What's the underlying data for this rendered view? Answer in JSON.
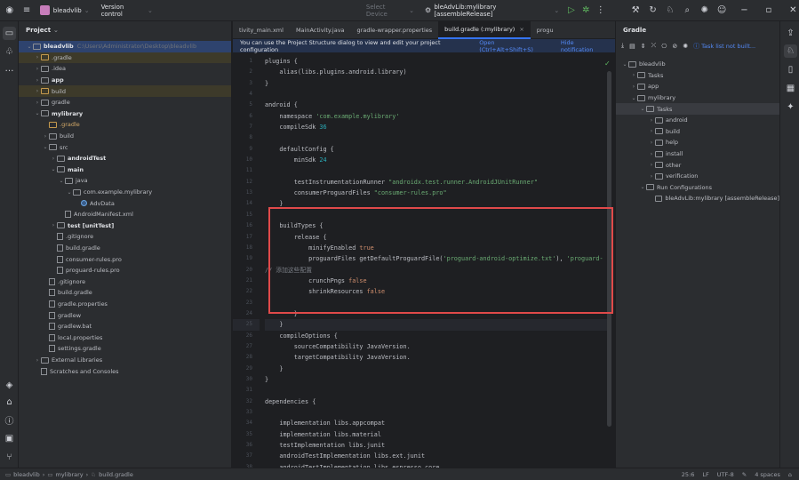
{
  "titlebar": {
    "project_name": "bleadvlib",
    "vcs": "Version control",
    "device": "Select Device",
    "run_config": "bleAdvLib:mylibrary [assembleRelease]"
  },
  "project_panel": {
    "title": "Project",
    "tree": [
      {
        "indent": 0,
        "chev": "v",
        "icon": "folder",
        "label": "bleadvlib",
        "bold": true,
        "extra": "C:\\Users\\Administrator\\Desktop\\bleadvlib",
        "sel": true
      },
      {
        "indent": 1,
        "chev": ">",
        "icon": "folder-orange",
        "label": ".gradle",
        "hl": true
      },
      {
        "indent": 1,
        "chev": ">",
        "icon": "folder",
        "label": ".idea"
      },
      {
        "indent": 1,
        "chev": ">",
        "icon": "folder",
        "label": "app",
        "bold": true
      },
      {
        "indent": 1,
        "chev": ">",
        "icon": "folder-orange",
        "label": "build",
        "hl": true
      },
      {
        "indent": 1,
        "chev": ">",
        "icon": "folder",
        "label": "gradle"
      },
      {
        "indent": 1,
        "chev": "v",
        "icon": "folder",
        "label": "mylibrary",
        "bold": true
      },
      {
        "indent": 2,
        "chev": "",
        "icon": "folder-orange",
        "label": ".gradle",
        "orange": true
      },
      {
        "indent": 2,
        "chev": ">",
        "icon": "folder",
        "label": "build"
      },
      {
        "indent": 2,
        "chev": "v",
        "icon": "folder",
        "label": "src"
      },
      {
        "indent": 3,
        "chev": ">",
        "icon": "folder",
        "label": "androidTest",
        "bold": true
      },
      {
        "indent": 3,
        "chev": "v",
        "icon": "folder",
        "label": "main",
        "bold": true
      },
      {
        "indent": 4,
        "chev": "v",
        "icon": "folder",
        "label": "java"
      },
      {
        "indent": 5,
        "chev": "v",
        "icon": "folder",
        "label": "com.example.mylibrary"
      },
      {
        "indent": 6,
        "chev": "",
        "icon": "kotlin",
        "label": "AdvData"
      },
      {
        "indent": 4,
        "chev": "",
        "icon": "file",
        "label": "AndroidManifest.xml"
      },
      {
        "indent": 3,
        "chev": ">",
        "icon": "folder",
        "label": "test [unitTest]",
        "bold": true
      },
      {
        "indent": 3,
        "chev": "",
        "icon": "file",
        "label": ".gitignore"
      },
      {
        "indent": 3,
        "chev": "",
        "icon": "file",
        "label": "build.gradle"
      },
      {
        "indent": 3,
        "chev": "",
        "icon": "file",
        "label": "consumer-rules.pro"
      },
      {
        "indent": 3,
        "chev": "",
        "icon": "file",
        "label": "proguard-rules.pro"
      },
      {
        "indent": 2,
        "chev": "",
        "icon": "file",
        "label": ".gitignore"
      },
      {
        "indent": 2,
        "chev": "",
        "icon": "file",
        "label": "build.gradle"
      },
      {
        "indent": 2,
        "chev": "",
        "icon": "file",
        "label": "gradle.properties"
      },
      {
        "indent": 2,
        "chev": "",
        "icon": "file",
        "label": "gradlew"
      },
      {
        "indent": 2,
        "chev": "",
        "icon": "file",
        "label": "gradlew.bat"
      },
      {
        "indent": 2,
        "chev": "",
        "icon": "file",
        "label": "local.properties"
      },
      {
        "indent": 2,
        "chev": "",
        "icon": "file",
        "label": "settings.gradle"
      },
      {
        "indent": 1,
        "chev": ">",
        "icon": "lib",
        "label": "External Libraries"
      },
      {
        "indent": 1,
        "chev": "",
        "icon": "file",
        "label": "Scratches and Consoles"
      }
    ]
  },
  "editor": {
    "tabs": [
      {
        "label": "tivity_main.xml",
        "active": false
      },
      {
        "label": "MainActivity.java",
        "active": false
      },
      {
        "label": "gradle-wrapper.properties",
        "active": false
      },
      {
        "label": "build.gradle (:mylibrary)",
        "active": true
      },
      {
        "label": "progu",
        "active": false
      }
    ],
    "notice": "You can use the Project Structure dialog to view and edit your project configuration",
    "notice_open": "Open (Ctrl+Alt+Shift+S)",
    "notice_hide": "Hide notification",
    "lines": [
      {
        "n": "1",
        "t": "plugins {"
      },
      {
        "n": "2",
        "t": "    alias(libs.plugins.android.library)"
      },
      {
        "n": "3",
        "t": "}"
      },
      {
        "n": "4",
        "t": ""
      },
      {
        "n": "5",
        "t": "android {"
      },
      {
        "n": "6",
        "t": "    namespace 'com.example.mylibrary'"
      },
      {
        "n": "7",
        "t": "    compileSdk 36"
      },
      {
        "n": "8",
        "t": ""
      },
      {
        "n": "9",
        "t": "    defaultConfig {"
      },
      {
        "n": "10",
        "t": "        minSdk 24"
      },
      {
        "n": "11",
        "t": ""
      },
      {
        "n": "12",
        "t": "        testInstrumentationRunner \"androidx.test.runner.AndroidJUnitRunner\""
      },
      {
        "n": "13",
        "t": "        consumerProguardFiles \"consumer-rules.pro\""
      },
      {
        "n": "14",
        "t": "    }"
      },
      {
        "n": "15",
        "t": ""
      },
      {
        "n": "16",
        "t": "    buildTypes {"
      },
      {
        "n": "17",
        "t": "        release {"
      },
      {
        "n": "18",
        "t": "            minifyEnabled true"
      },
      {
        "n": "19",
        "t": "            proguardFiles getDefaultProguardFile('proguard-android-optimize.txt'), 'proguard-"
      },
      {
        "n": "20",
        "t": "// 添加这些配置"
      },
      {
        "n": "21",
        "t": "            crunchPngs false"
      },
      {
        "n": "22",
        "t": "            shrinkResources false"
      },
      {
        "n": "23",
        "t": ""
      },
      {
        "n": "24",
        "t": "        }"
      },
      {
        "n": "25",
        "t": "    }"
      },
      {
        "n": "26",
        "t": "    compileOptions {"
      },
      {
        "n": "27",
        "t": "        sourceCompatibility JavaVersion.VERSION_11"
      },
      {
        "n": "28",
        "t": "        targetCompatibility JavaVersion.VERSION_11"
      },
      {
        "n": "29",
        "t": "    }"
      },
      {
        "n": "30",
        "t": "}"
      },
      {
        "n": "31",
        "t": ""
      },
      {
        "n": "32",
        "t": "dependencies {"
      },
      {
        "n": "33",
        "t": ""
      },
      {
        "n": "34",
        "t": "    implementation libs.appcompat"
      },
      {
        "n": "35",
        "t": "    implementation libs.material"
      },
      {
        "n": "36",
        "t": "    testImplementation libs.junit"
      },
      {
        "n": "37",
        "t": "    androidTestImplementation libs.ext.junit"
      },
      {
        "n": "38",
        "t": "    androidTestImplementation libs.espresso.core"
      },
      {
        "n": "39",
        "t": "}"
      }
    ]
  },
  "gradle_panel": {
    "title": "Gradle",
    "task_list_msg": "Task list not built...",
    "tree": [
      {
        "indent": 0,
        "chev": "v",
        "label": "bleadvlib"
      },
      {
        "indent": 1,
        "chev": ">",
        "label": "Tasks"
      },
      {
        "indent": 1,
        "chev": ">",
        "label": "app"
      },
      {
        "indent": 1,
        "chev": "v",
        "label": "mylibrary"
      },
      {
        "indent": 2,
        "chev": "v",
        "label": "Tasks",
        "sel": true
      },
      {
        "indent": 3,
        "chev": ">",
        "label": "android"
      },
      {
        "indent": 3,
        "chev": ">",
        "label": "build"
      },
      {
        "indent": 3,
        "chev": ">",
        "label": "help"
      },
      {
        "indent": 3,
        "chev": ">",
        "label": "install"
      },
      {
        "indent": 3,
        "chev": ">",
        "label": "other"
      },
      {
        "indent": 3,
        "chev": ">",
        "label": "verification"
      },
      {
        "indent": 2,
        "chev": "v",
        "label": "Run Configurations"
      },
      {
        "indent": 3,
        "chev": "",
        "label": "bleAdvLib:mylibrary [assembleRelease]"
      }
    ]
  },
  "statusbar": {
    "breadcrumb": [
      "bleadvlib",
      "mylibrary",
      "build.gradle"
    ],
    "position": "25:6",
    "line_ending": "LF",
    "encoding": "UTF-8",
    "indent": "4 spaces"
  },
  "colors": {
    "accent": "#3574f0",
    "highlight_box": "#e04a4a"
  }
}
